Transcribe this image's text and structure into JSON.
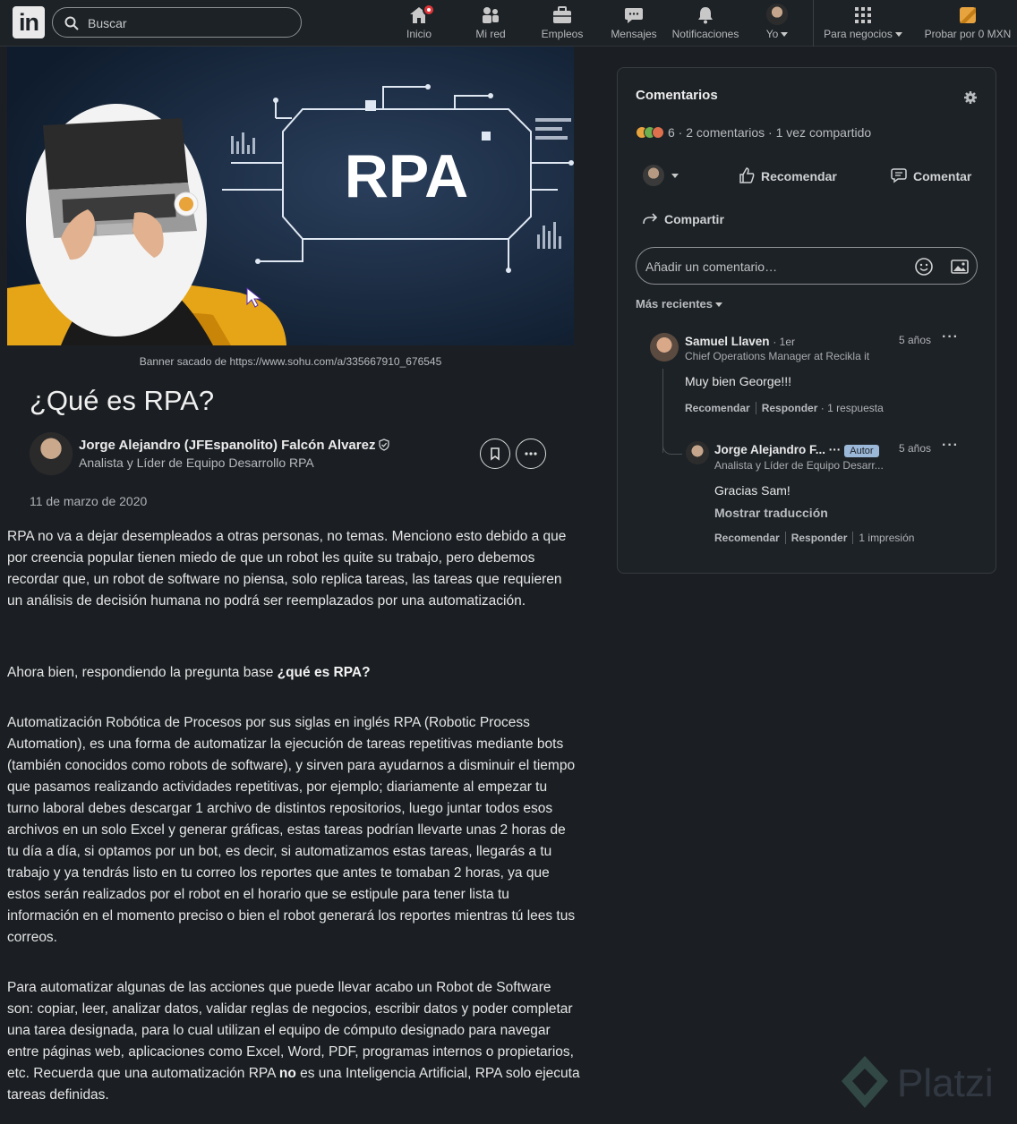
{
  "nav": {
    "search_placeholder": "Buscar",
    "items": [
      "Inicio",
      "Mi red",
      "Empleos",
      "Mensajes",
      "Notificaciones",
      "Yo",
      "Para negocios",
      "Probar por 0 MXN"
    ]
  },
  "article": {
    "banner_text": "RPA",
    "caption": "Banner sacado de https://www.sohu.com/a/335667910_676545",
    "title": "¿Qué es RPA?",
    "author_name": "Jorge Alejandro (JFEspanolito) Falcón Alvarez",
    "author_headline": "Analista y Líder de Equipo Desarrollo RPA",
    "date": "11 de marzo de 2020",
    "p1": "RPA no va a dejar desempleados a otras personas, no temas. Menciono esto debido a que por creencia popular tienen miedo de que un robot les quite su trabajo, pero debemos recordar que, un robot de software no piensa, solo replica tareas, las tareas que requieren un análisis de decisión humana no podrá ser reemplazados por una automatización.",
    "p2_prefix": "Ahora bien, respondiendo la pregunta base ",
    "p2_bold": "¿qué es RPA?",
    "p3": "Automatización Robótica de Procesos por sus siglas en inglés RPA (Robotic Process Automation), es una forma de automatizar la ejecución de tareas repetitivas mediante bots (también conocidos como robots de software), y sirven para ayudarnos a disminuir el tiempo que pasamos realizando actividades repetitivas, por ejemplo; diariamente al empezar tu turno laboral debes descargar 1 archivo de distintos repositorios, luego juntar todos esos archivos en un solo Excel y generar gráficas, estas tareas podrían llevarte unas 2 horas de tu día a día, si optamos por un bot, es decir, si automatizamos estas tareas, llegarás a tu trabajo y ya tendrás listo en tu correo los reportes que antes te tomaban 2 horas, ya que estos serán realizados por el robot en el horario que se estipule para tener lista tu información en el momento preciso o bien el robot generará los reportes mientras tú lees tus correos.",
    "p4_a": "Para automatizar algunas de las acciones que puede llevar acabo un Robot de Software son: copiar, leer, analizar datos, validar reglas de negocios, escribir datos y poder completar una tarea designada, para lo cual utilizan el equipo de cómputo designado para navegar entre páginas web, aplicaciones como Excel, Word, PDF, programas internos o propietarios, etc. Recuerda que una automatización RPA ",
    "p4_bold": "no",
    "p4_b": " es una Inteligencia Artificial, RPA solo ejecuta tareas definidas."
  },
  "comments_panel": {
    "title": "Comentarios",
    "stats": "6 · 2 comentarios · 1 vez compartido",
    "recommend": "Recomendar",
    "comment": "Comentar",
    "share": "Compartir",
    "input_placeholder": "Añadir un comentario…",
    "sort_label": "Más recientes",
    "comments": [
      {
        "name": "Samuel Llaven",
        "degree": "· 1er",
        "headline": "Chief Operations Manager at Recikla it",
        "time": "5 años",
        "text": "Muy bien George!!!",
        "like": "Recomendar",
        "reply": "Responder",
        "extra": "· 1 respuesta"
      },
      {
        "name": "Jorge Alejandro F... ···",
        "badge": "Autor",
        "headline": "Analista y Líder de Equipo Desarr...",
        "time": "5 años",
        "text": "Gracias Sam!",
        "translate": "Mostrar traducción",
        "like": "Recomendar",
        "reply": "Responder",
        "extra": "1 impresión"
      }
    ]
  },
  "watermark": "Platzi"
}
